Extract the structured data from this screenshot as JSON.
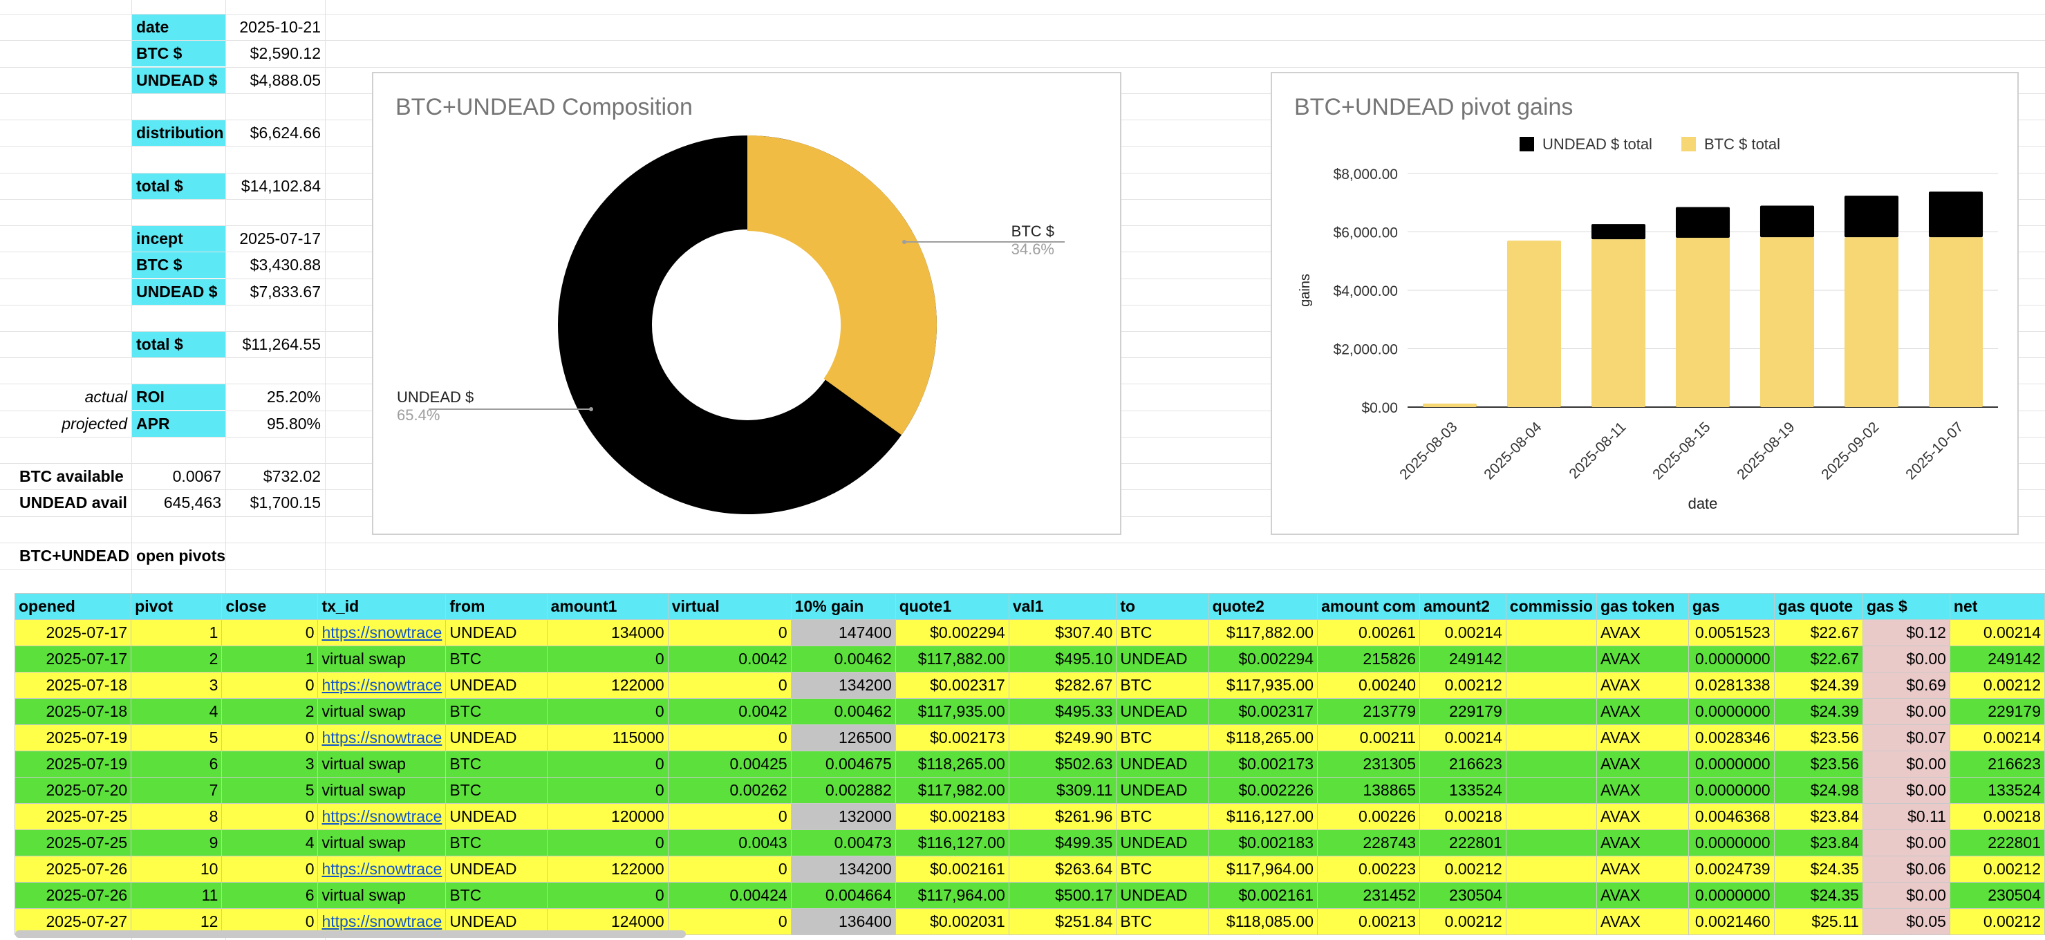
{
  "summary": {
    "date_label": "date",
    "date_value": "2025-10-21",
    "btc_label": "BTC $",
    "btc_value": "$2,590.12",
    "undead_label": "UNDEAD $",
    "undead_value": "$4,888.05",
    "distribution_label": "distribution",
    "distribution_value": "$6,624.66",
    "total_label": "total $",
    "total_value": "$14,102.84",
    "incept_label": "incept",
    "incept_value": "2025-07-17",
    "btc2_label": "BTC $",
    "btc2_value": "$3,430.88",
    "undead2_label": "UNDEAD $",
    "undead2_value": "$7,833.67",
    "total2_label": "total $",
    "total2_value": "$11,264.55",
    "actual_label": "actual",
    "roi_label": "ROI",
    "roi_value": "25.20%",
    "projected_label": "projected",
    "apr_label": "APR",
    "apr_value": "95.80%",
    "btc_avail_label": "BTC available",
    "btc_avail_qty": "0.0067",
    "btc_avail_value": "$732.02",
    "undead_avail_label": "UNDEAD avail",
    "undead_avail_qty": "645,463",
    "undead_avail_value": "$1,700.15",
    "open_pivots_label": "BTC+UNDEAD",
    "open_pivots_label2": "open pivots"
  },
  "donut": {
    "title": "BTC+UNDEAD Composition",
    "btc_label": "BTC $",
    "btc_pct": "34.6%",
    "undead_label": "UNDEAD $",
    "undead_pct": "65.4%"
  },
  "chart_data": {
    "type": "bar",
    "title": "BTC+UNDEAD pivot gains",
    "xlabel": "date",
    "ylabel": "gains",
    "categories": [
      "2025-08-03",
      "2025-08-04",
      "2025-08-11",
      "2025-08-15",
      "2025-08-19",
      "2025-09-02",
      "2025-10-07"
    ],
    "series": [
      {
        "name": "BTC $ total",
        "color": "#f7d774",
        "values": [
          120,
          5700,
          5750,
          5800,
          5820,
          5820,
          5820
        ]
      },
      {
        "name": "UNDEAD $ total",
        "color": "#000000",
        "values": [
          0,
          0,
          520,
          1050,
          1080,
          1420,
          1560
        ]
      }
    ],
    "yticks": [
      "$0.00",
      "$2,000.00",
      "$4,000.00",
      "$6,000.00",
      "$8,000.00"
    ],
    "ylim": [
      0,
      8000
    ],
    "legend": "top"
  },
  "table": {
    "headers": [
      "opened",
      "pivot",
      "close",
      "tx_id",
      "from",
      "amount1",
      "virtual",
      "10% gain",
      "quote1",
      "val1",
      "to",
      "quote2",
      "amount com",
      "amount2",
      "commissio",
      "gas token",
      "gas",
      "gas quote",
      "gas $",
      "net"
    ],
    "rows": [
      [
        "2025-07-17",
        "1",
        "0",
        "https://snowtrace",
        "UNDEAD",
        "134000",
        "0",
        "147400",
        "$0.002294",
        "$307.40",
        "BTC",
        "$117,882.00",
        "0.00261",
        "0.00214",
        "",
        "AVAX",
        "0.0051523",
        "$22.67",
        "$0.12",
        "0.00214"
      ],
      [
        "2025-07-17",
        "2",
        "1",
        "virtual swap",
        "BTC",
        "0",
        "0.0042",
        "0.00462",
        "$117,882.00",
        "$495.10",
        "UNDEAD",
        "$0.002294",
        "215826",
        "249142",
        "",
        "AVAX",
        "0.0000000",
        "$22.67",
        "$0.00",
        "249142"
      ],
      [
        "2025-07-18",
        "3",
        "0",
        "https://snowtrace",
        "UNDEAD",
        "122000",
        "0",
        "134200",
        "$0.002317",
        "$282.67",
        "BTC",
        "$117,935.00",
        "0.00240",
        "0.00212",
        "",
        "AVAX",
        "0.0281338",
        "$24.39",
        "$0.69",
        "0.00212"
      ],
      [
        "2025-07-18",
        "4",
        "2",
        "virtual swap",
        "BTC",
        "0",
        "0.0042",
        "0.00462",
        "$117,935.00",
        "$495.33",
        "UNDEAD",
        "$0.002317",
        "213779",
        "229179",
        "",
        "AVAX",
        "0.0000000",
        "$24.39",
        "$0.00",
        "229179"
      ],
      [
        "2025-07-19",
        "5",
        "0",
        "https://snowtrace",
        "UNDEAD",
        "115000",
        "0",
        "126500",
        "$0.002173",
        "$249.90",
        "BTC",
        "$118,265.00",
        "0.00211",
        "0.00214",
        "",
        "AVAX",
        "0.0028346",
        "$23.56",
        "$0.07",
        "0.00214"
      ],
      [
        "2025-07-19",
        "6",
        "3",
        "virtual swap",
        "BTC",
        "0",
        "0.00425",
        "0.004675",
        "$118,265.00",
        "$502.63",
        "UNDEAD",
        "$0.002173",
        "231305",
        "216623",
        "",
        "AVAX",
        "0.0000000",
        "$23.56",
        "$0.00",
        "216623"
      ],
      [
        "2025-07-20",
        "7",
        "5",
        "virtual swap",
        "BTC",
        "0",
        "0.00262",
        "0.002882",
        "$117,982.00",
        "$309.11",
        "UNDEAD",
        "$0.002226",
        "138865",
        "133524",
        "",
        "AVAX",
        "0.0000000",
        "$24.98",
        "$0.00",
        "133524"
      ],
      [
        "2025-07-25",
        "8",
        "0",
        "https://snowtrace",
        "UNDEAD",
        "120000",
        "0",
        "132000",
        "$0.002183",
        "$261.96",
        "BTC",
        "$116,127.00",
        "0.00226",
        "0.00218",
        "",
        "AVAX",
        "0.0046368",
        "$23.84",
        "$0.11",
        "0.00218"
      ],
      [
        "2025-07-25",
        "9",
        "4",
        "virtual swap",
        "BTC",
        "0",
        "0.0043",
        "0.00473",
        "$116,127.00",
        "$499.35",
        "UNDEAD",
        "$0.002183",
        "228743",
        "222801",
        "",
        "AVAX",
        "0.0000000",
        "$23.84",
        "$0.00",
        "222801"
      ],
      [
        "2025-07-26",
        "10",
        "0",
        "https://snowtrace",
        "UNDEAD",
        "122000",
        "0",
        "134200",
        "$0.002161",
        "$263.64",
        "BTC",
        "$117,964.00",
        "0.00223",
        "0.00212",
        "",
        "AVAX",
        "0.0024739",
        "$24.35",
        "$0.06",
        "0.00212"
      ],
      [
        "2025-07-26",
        "11",
        "6",
        "virtual swap",
        "BTC",
        "0",
        "0.00424",
        "0.004664",
        "$117,964.00",
        "$500.17",
        "UNDEAD",
        "$0.002161",
        "231452",
        "230504",
        "",
        "AVAX",
        "0.0000000",
        "$24.35",
        "$0.00",
        "230504"
      ],
      [
        "2025-07-27",
        "12",
        "0",
        "https://snowtrace",
        "UNDEAD",
        "124000",
        "0",
        "136400",
        "$0.002031",
        "$251.84",
        "BTC",
        "$118,085.00",
        "0.00213",
        "0.00212",
        "",
        "AVAX",
        "0.0021460",
        "$25.11",
        "$0.05",
        "0.00212"
      ]
    ]
  }
}
